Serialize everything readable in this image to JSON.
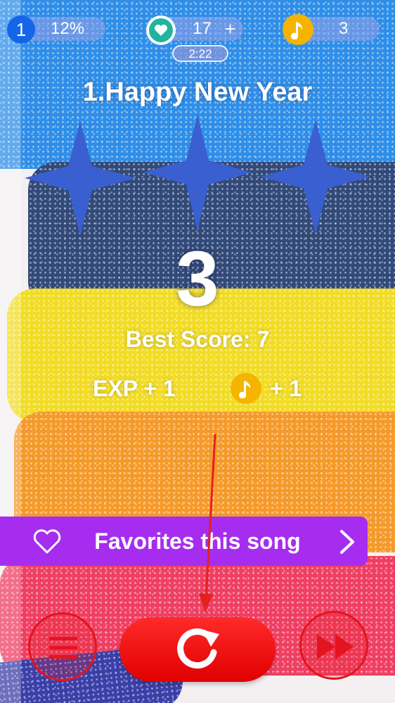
{
  "hud": {
    "level": "1",
    "progress": "12%",
    "lives": "17",
    "lives_add": "+",
    "notes": "3",
    "timer": "2:22"
  },
  "song": {
    "title": "1.Happy New Year",
    "stars_total": 3,
    "stars_earned": 0
  },
  "result": {
    "score": "3",
    "best_score": "Best Score: 7",
    "exp_reward": "EXP + 1",
    "note_reward": "+ 1"
  },
  "favorite": {
    "label": "Favorites this song"
  },
  "colors": {
    "accent_blue": "#1565e8",
    "star_blue": "#3a5fd0",
    "note_gold": "#f4b400",
    "favorite_purple": "#a62df0",
    "action_red": "#e4141e"
  },
  "icons": {
    "level_badge": "level-badge-icon",
    "lives": "heart-icon",
    "notes": "music-note-icon",
    "favorite": "heart-outline-icon",
    "next_arrow": "chevron-right-icon",
    "menu": "menu-icon",
    "replay": "replay-icon",
    "next_song": "fast-forward-icon"
  }
}
